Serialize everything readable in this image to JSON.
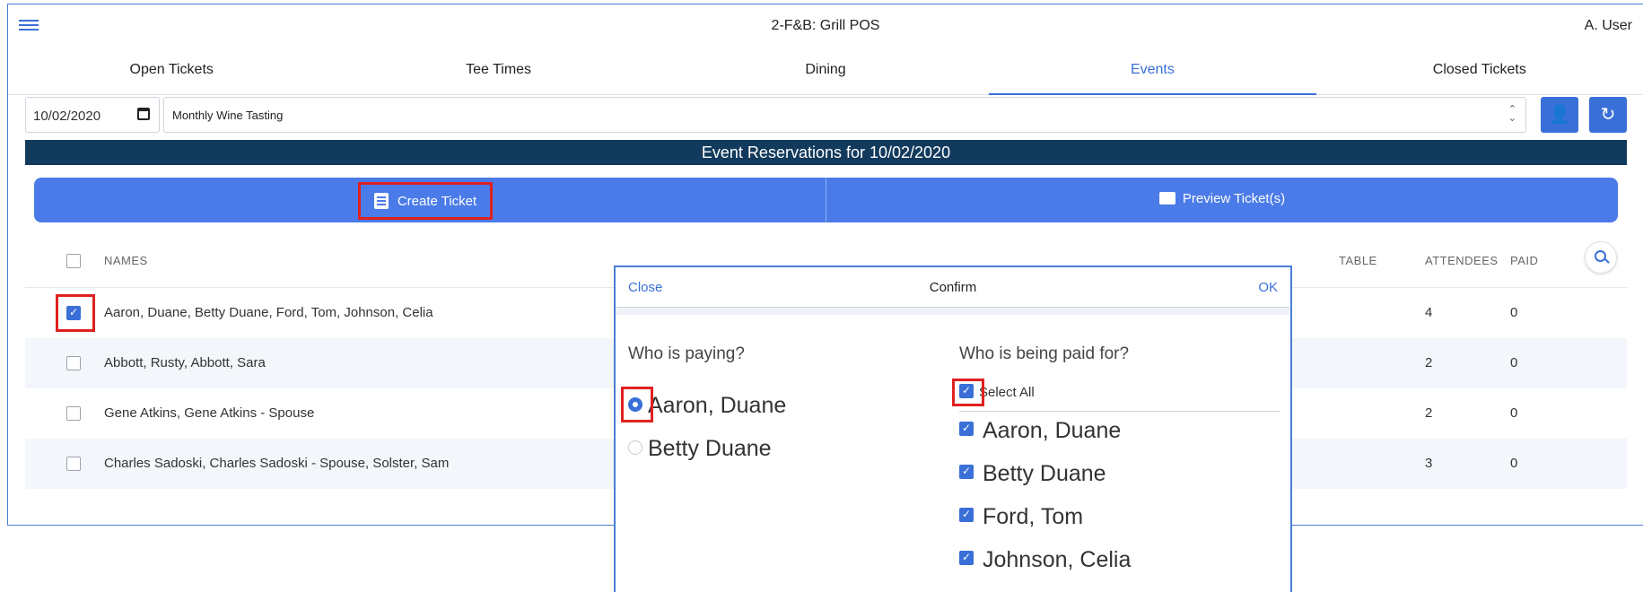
{
  "app": {
    "title": "2-F&B: Grill POS",
    "user": "A. User"
  },
  "tabs": [
    {
      "label": "Open Tickets",
      "active": false
    },
    {
      "label": "Tee Times",
      "active": false
    },
    {
      "label": "Dining",
      "active": false
    },
    {
      "label": "Events",
      "active": true
    },
    {
      "label": "Closed Tickets",
      "active": false
    }
  ],
  "filters": {
    "date": "10/02/2020",
    "event": "Monthly Wine Tasting"
  },
  "icons": {
    "menu": "hamburger-icon",
    "calendar": "calendar-icon",
    "select": "up-down-icon",
    "person": "person-icon",
    "refresh": "refresh-icon",
    "create": "document-icon",
    "preview": "printer-icon",
    "search": "search-icon"
  },
  "reservations_title": "Event Reservations for 10/02/2020",
  "actions": {
    "create_ticket": "Create Ticket",
    "preview_tickets": "Preview Ticket(s)"
  },
  "table": {
    "columns": {
      "names": "NAMES",
      "table": "TABLE",
      "attendees": "ATTENDEES",
      "paid": "PAID"
    },
    "rows": [
      {
        "names": "Aaron, Duane, Betty Duane, Ford, Tom, Johnson, Celia",
        "attendees": "4",
        "paid": "0",
        "checked": true
      },
      {
        "names": "Abbott, Rusty, Abbott, Sara",
        "attendees": "2",
        "paid": "0",
        "checked": false
      },
      {
        "names": "Gene Atkins, Gene Atkins - Spouse",
        "attendees": "2",
        "paid": "0",
        "checked": false
      },
      {
        "names": "Charles Sadoski, Charles Sadoski - Spouse, Solster, Sam",
        "attendees": "3",
        "paid": "0",
        "checked": false
      }
    ]
  },
  "modal": {
    "close": "Close",
    "title": "Confirm",
    "ok": "OK",
    "payer_question": "Who is paying?",
    "payers": [
      {
        "name": "Aaron, Duane",
        "selected": true
      },
      {
        "name": "Betty Duane",
        "selected": false
      }
    ],
    "payee_question": "Who is being paid for?",
    "select_all": "Select All",
    "payees": [
      {
        "name": "Aaron, Duane",
        "checked": true
      },
      {
        "name": "Betty Duane",
        "checked": true
      },
      {
        "name": "Ford, Tom",
        "checked": true
      },
      {
        "name": "Johnson, Celia",
        "checked": true
      }
    ]
  },
  "colors": {
    "accent": "#3a6fd8",
    "header_band": "#123a5c",
    "action_bar": "#4a7be8",
    "highlight": "#e02020"
  }
}
